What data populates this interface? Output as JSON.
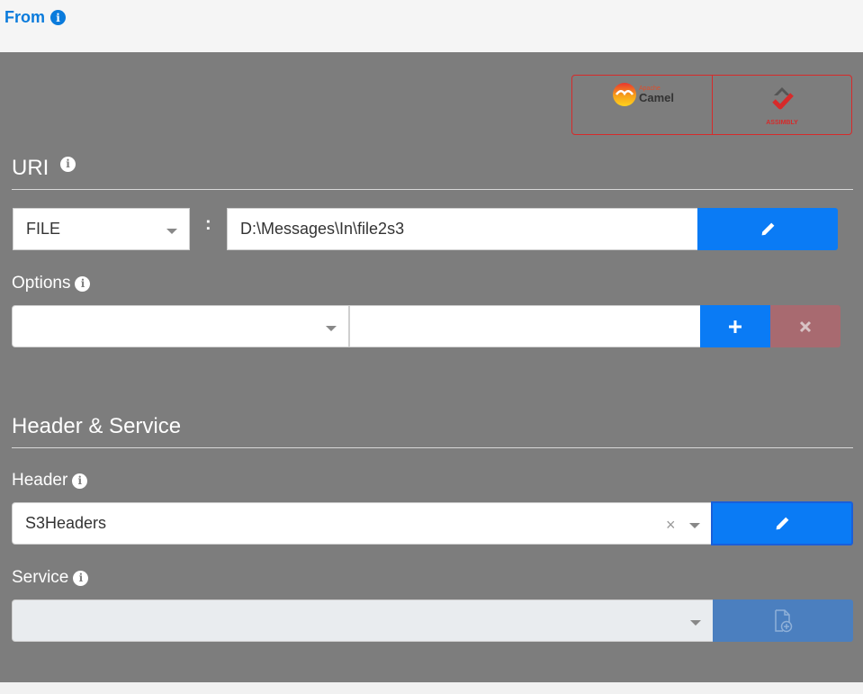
{
  "header": {
    "title": "From",
    "info_icon": "info-circle-icon"
  },
  "logos": {
    "camel_small": "Apache",
    "camel_big": "Camel",
    "assimbly": "ASSIMBLY"
  },
  "uri": {
    "section_title": "URI",
    "scheme": "FILE",
    "separator": ":",
    "path": "D:\\Messages\\In\\file2s3",
    "edit_icon": "pencil-icon"
  },
  "options": {
    "label": "Options",
    "key_value": "",
    "value_value": "",
    "add_icon": "plus-icon",
    "remove_icon": "times-icon"
  },
  "header_service": {
    "section_title": "Header & Service",
    "header_label": "Header",
    "header_value": "S3Headers",
    "clear_glyph": "×",
    "service_label": "Service",
    "service_value": "",
    "add_file_icon": "file-plus-icon"
  },
  "colors": {
    "primary": "#0a7bf5",
    "danger_disabled": "#a86a70",
    "panel_bg": "#7d7d7d",
    "brand_red": "#d72a2a"
  }
}
